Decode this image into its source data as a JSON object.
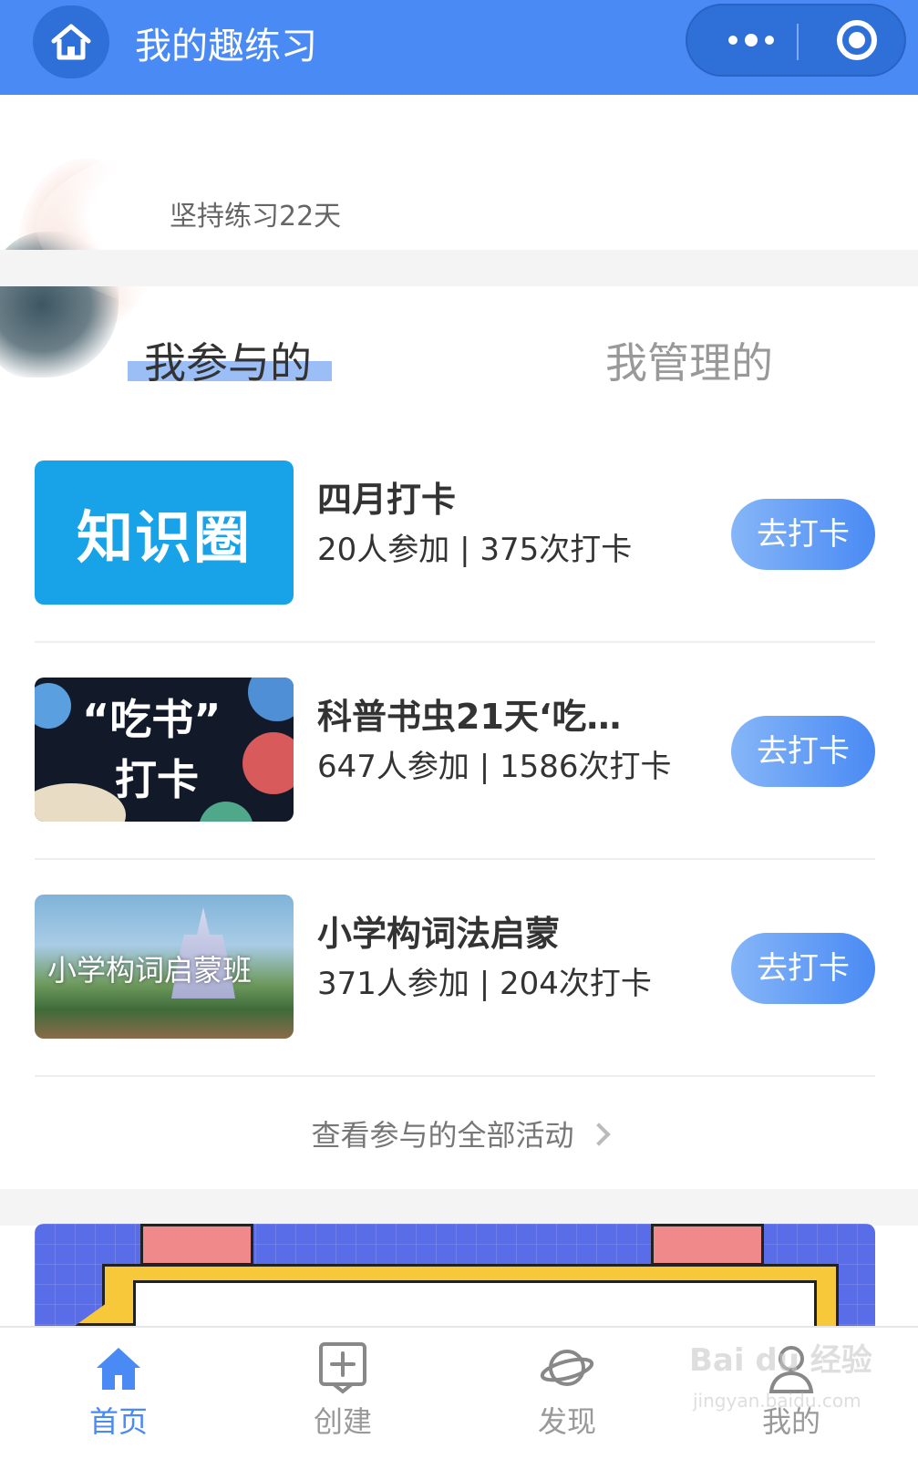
{
  "header": {
    "title": "我的趣练习",
    "colors": {
      "primary": "#4a8af4",
      "capsule": "#2f6fd8"
    },
    "icons": {
      "home": "home-icon",
      "more": "more-dots-icon",
      "close": "target-circle-icon"
    }
  },
  "profile": {
    "streak_text": "坚持练习22天"
  },
  "tabs": [
    {
      "label": "我参与的",
      "active": true
    },
    {
      "label": "我管理的",
      "active": false
    }
  ],
  "activities": [
    {
      "thumb_text": "知识圈",
      "title": "四月打卡",
      "stats": "20人参加 | 375次打卡",
      "button": "去打卡"
    },
    {
      "thumb_text_line1": "“吃书”",
      "thumb_text_line2": "打卡",
      "title": "科普书虫21天‘吃…",
      "stats": "647人参加 | 1586次打卡",
      "button": "去打卡"
    },
    {
      "thumb_text": "小学构词启蒙班",
      "title": "小学构词法启蒙",
      "stats": "371人参加 | 204次打卡",
      "button": "去打卡"
    }
  ],
  "view_all": "查看参与的全部活动",
  "tabbar": [
    {
      "label": "首页",
      "icon": "home-icon",
      "active": true
    },
    {
      "label": "创建",
      "icon": "plus-square-icon",
      "active": false
    },
    {
      "label": "发现",
      "icon": "planet-icon",
      "active": false
    },
    {
      "label": "我的",
      "icon": "user-icon",
      "active": false
    }
  ],
  "watermark": {
    "line1": "Bai du 经验",
    "line2": "jingyan.baidu.com"
  }
}
